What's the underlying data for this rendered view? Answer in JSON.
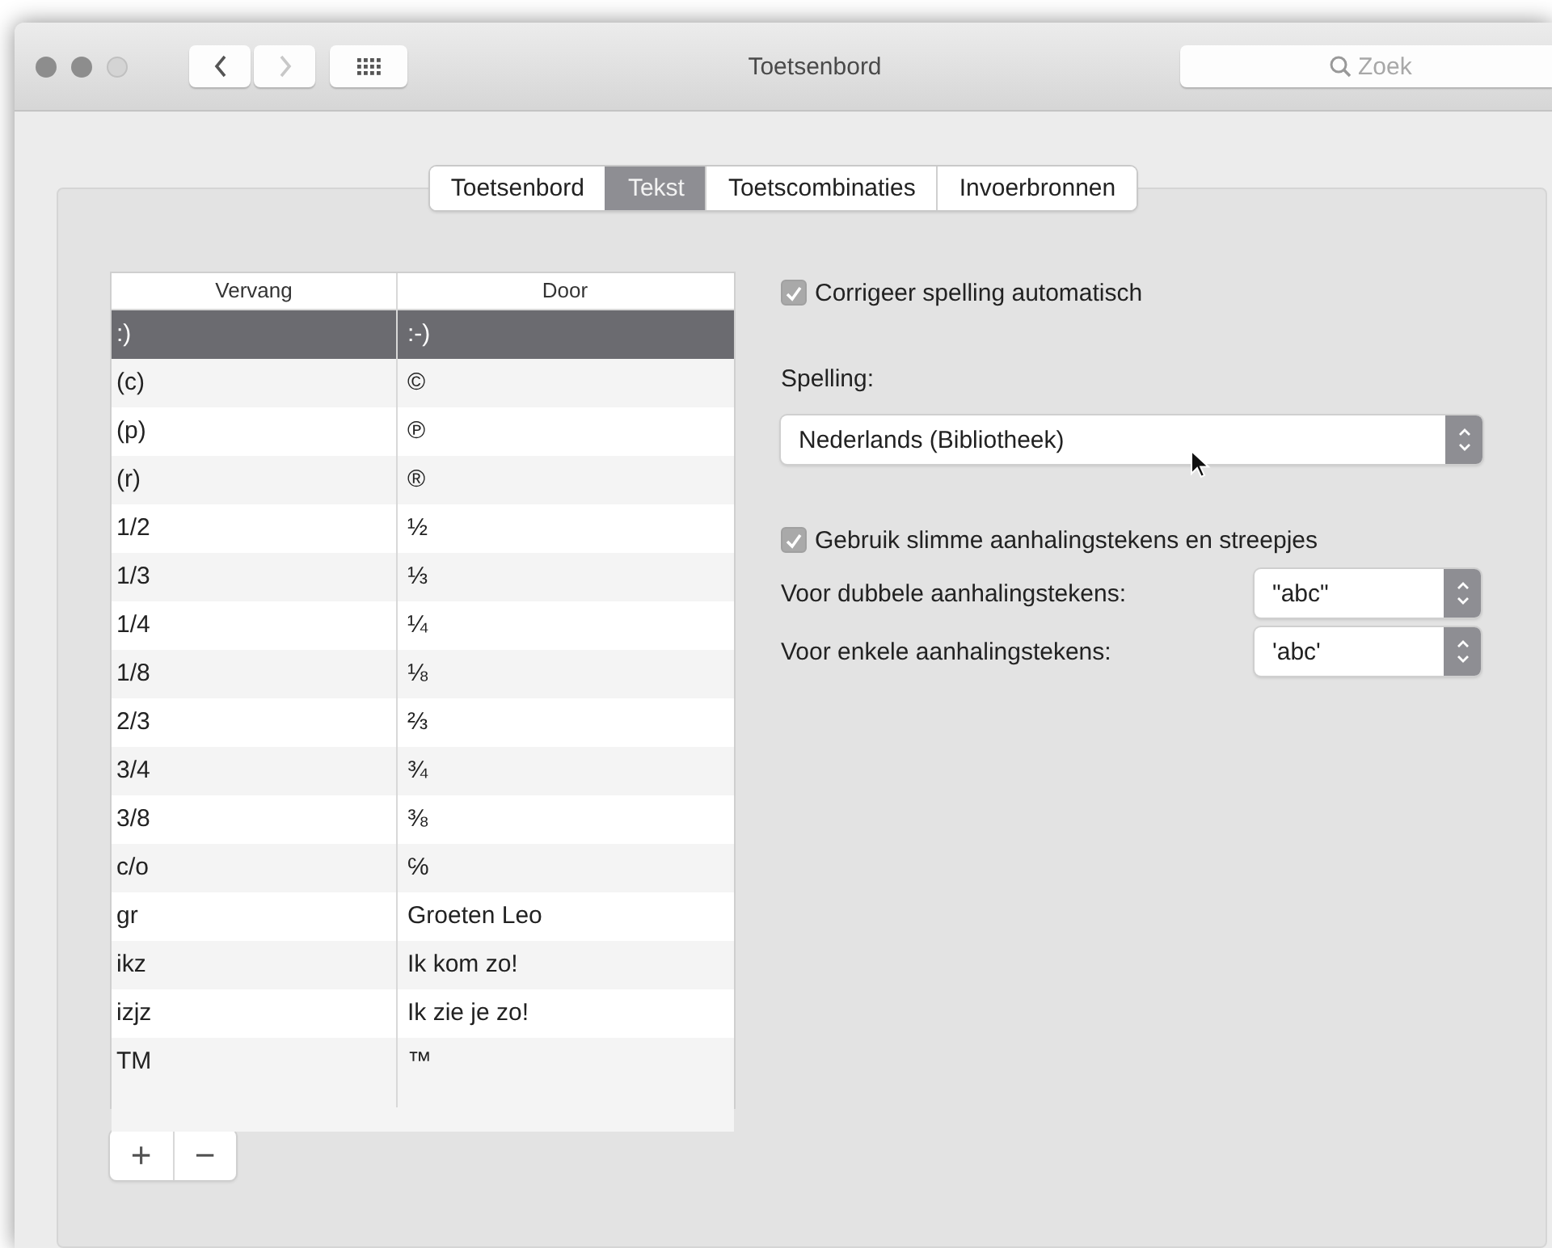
{
  "window": {
    "title": "Toetsenbord"
  },
  "nav_buttons": [
    {
      "kind": "back",
      "disabled": false
    },
    {
      "kind": "forward",
      "disabled": true
    }
  ],
  "search": {
    "placeholder": "Zoek"
  },
  "tabs": [
    {
      "label": "Toetsenbord",
      "selected": false
    },
    {
      "label": "Tekst",
      "selected": true
    },
    {
      "label": "Toetscombinaties",
      "selected": false
    },
    {
      "label": "Invoerbronnen",
      "selected": false
    }
  ],
  "table": {
    "columns": [
      "Vervang",
      "Door"
    ],
    "rows": [
      {
        "cells": [
          ":)",
          ":-)"
        ],
        "selected": true
      },
      {
        "cells": [
          "(c)",
          "©"
        ],
        "selected": false
      },
      {
        "cells": [
          "(p)",
          "℗"
        ],
        "selected": false
      },
      {
        "cells": [
          "(r)",
          "®"
        ],
        "selected": false
      },
      {
        "cells": [
          "1/2",
          "½"
        ],
        "selected": false
      },
      {
        "cells": [
          "1/3",
          "⅓"
        ],
        "selected": false
      },
      {
        "cells": [
          "1/4",
          "¼"
        ],
        "selected": false
      },
      {
        "cells": [
          "1/8",
          "⅛"
        ],
        "selected": false
      },
      {
        "cells": [
          "2/3",
          "⅔"
        ],
        "selected": false
      },
      {
        "cells": [
          "3/4",
          "¾"
        ],
        "selected": false
      },
      {
        "cells": [
          "3/8",
          "⅜"
        ],
        "selected": false
      },
      {
        "cells": [
          "c/o",
          "℅"
        ],
        "selected": false
      },
      {
        "cells": [
          "gr",
          "Groeten Leo"
        ],
        "selected": false
      },
      {
        "cells": [
          "ikz",
          "Ik kom zo!"
        ],
        "selected": false
      },
      {
        "cells": [
          "izjz",
          "Ik zie je zo!"
        ],
        "selected": false
      },
      {
        "cells": [
          "TM",
          "™"
        ],
        "selected": false
      }
    ]
  },
  "table_buttons": [
    "+",
    "−"
  ],
  "options": [
    {
      "kind": "checkbox",
      "label": "Corrigeer spelling automatisch",
      "checked": true
    },
    {
      "kind": "heading",
      "label": "Spelling:"
    },
    {
      "kind": "popup",
      "value": "Nederlands (Bibliotheek)"
    },
    {
      "kind": "checkbox",
      "label": "Gebruik slimme aanhalingstekens en streepjes",
      "checked": true
    },
    {
      "kind": "labeled_popup",
      "label": "Voor dubbele aanhalingstekens:",
      "value": "\"abc\""
    },
    {
      "kind": "labeled_popup",
      "label": "Voor enkele aanhalingstekens:",
      "value": "'abc'"
    }
  ]
}
